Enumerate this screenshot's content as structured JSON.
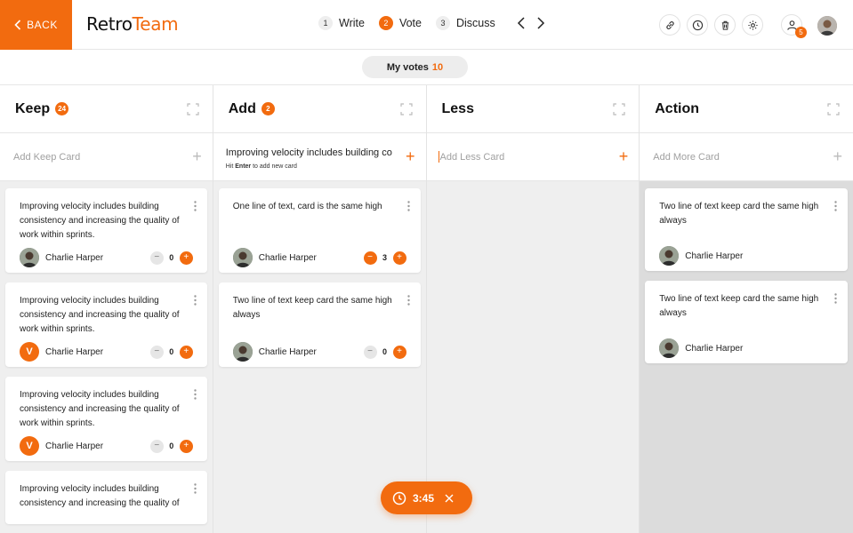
{
  "header": {
    "back_label": "BACK",
    "logo_part1": "Retro",
    "logo_part2": "Team",
    "steps": [
      {
        "num": "1",
        "label": "Write"
      },
      {
        "num": "2",
        "label": "Vote"
      },
      {
        "num": "3",
        "label": "Discuss"
      }
    ],
    "users_count": "5"
  },
  "votes": {
    "label": "My votes",
    "count": "10"
  },
  "columns": [
    {
      "title": "Keep",
      "badge": "24",
      "add_placeholder": "Add Keep Card"
    },
    {
      "title": "Add",
      "badge": "2",
      "add_typing": "Improving velocity includes building co",
      "add_hint_pre": "Hit ",
      "add_hint_key": "Enter",
      "add_hint_post": " to add new card"
    },
    {
      "title": "Less",
      "add_placeholder": "Add Less Card"
    },
    {
      "title": "Action",
      "add_placeholder": "Add More Card"
    }
  ],
  "cards": {
    "keep": [
      {
        "text": "Improving velocity includes building consistency and increasing the quality of work within sprints.",
        "author": "Charlie Harper",
        "votes": "0"
      },
      {
        "text": "Improving velocity includes building consistency and increasing the quality of work within sprints.",
        "author": "Charlie Harper",
        "avatar_letter": "V",
        "votes": "0"
      },
      {
        "text": "Improving velocity includes building consistency and increasing the quality of work within sprints.",
        "author": "Charlie Harper",
        "avatar_letter": "V",
        "votes": "0"
      },
      {
        "text": "Improving velocity includes building consistency and increasing the quality of"
      }
    ],
    "add": [
      {
        "text": "One line of text, card is the same high",
        "author": "Charlie Harper",
        "votes": "3"
      },
      {
        "text": "Two line of text keep card the same high always",
        "author": "Charlie Harper",
        "votes": "0"
      }
    ],
    "action": [
      {
        "text": "Two line of text keep card the same high always",
        "author": "Charlie Harper"
      },
      {
        "text": "Two line of text keep card the same high always",
        "author": "Charlie Harper"
      }
    ]
  },
  "timer": {
    "time": "3:45"
  },
  "colors": {
    "accent": "#f26b0f"
  }
}
